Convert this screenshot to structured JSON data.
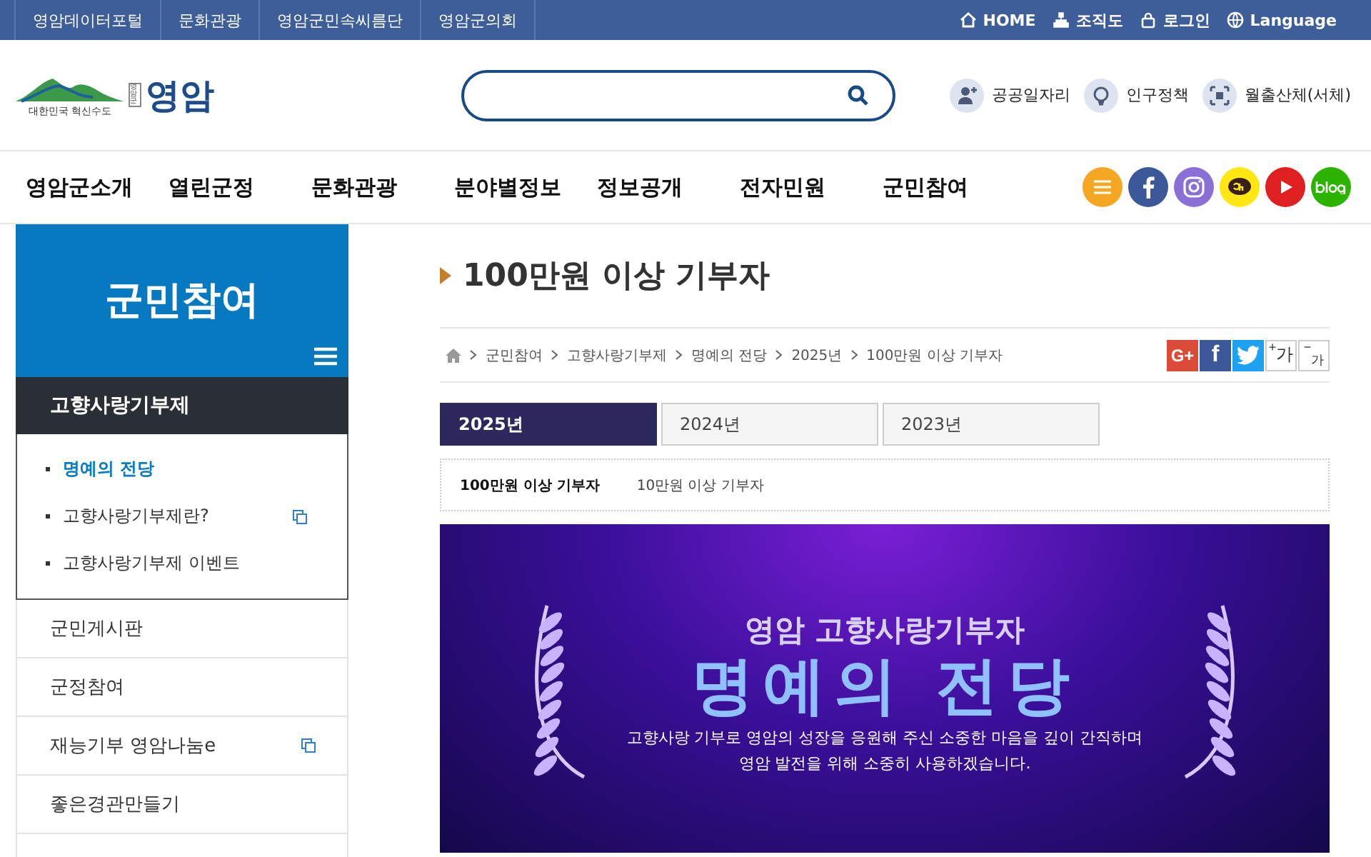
{
  "top_bar": {
    "links": [
      "영암데이터포털",
      "문화관광",
      "영암군민속씨름단",
      "영암군의회"
    ],
    "utility": [
      {
        "kind": "home",
        "label": "HOME"
      },
      {
        "kind": "org",
        "label": "조직도"
      },
      {
        "kind": "lock",
        "label": "로그인"
      },
      {
        "kind": "globe",
        "label": "Language"
      }
    ]
  },
  "header": {
    "logo": {
      "slogan": "대한민국 혁신수도",
      "name": "영암",
      "seal": "영암군"
    },
    "quick_links": [
      {
        "kind": "person",
        "label": "공공일자리"
      },
      {
        "kind": "bulb",
        "label": "인구정책"
      },
      {
        "kind": "frame",
        "label": "월출산체(서체)"
      }
    ]
  },
  "nav": {
    "items": [
      "영암군소개",
      "열린군정",
      "문화관광",
      "분야별정보",
      "정보공개",
      "전자민원",
      "군민참여"
    ],
    "social": [
      {
        "kind": "menu",
        "color": "#f5a623"
      },
      {
        "kind": "facebook",
        "color": "#3b5998"
      },
      {
        "kind": "instagram",
        "color": "#8a6fd6"
      },
      {
        "kind": "kakao",
        "color": "#ffe812"
      },
      {
        "kind": "youtube",
        "color": "#e02020"
      },
      {
        "kind": "blog",
        "color": "#2db400"
      }
    ]
  },
  "sidebar": {
    "title": "군민참여",
    "section": "고향사랑기부제",
    "subitems": [
      {
        "label": "명예의 전당",
        "selected": true,
        "external": false
      },
      {
        "label": "고향사랑기부제란?",
        "selected": false,
        "external": true
      },
      {
        "label": "고향사랑기부제 이벤트",
        "selected": false,
        "external": false
      }
    ],
    "items": [
      {
        "label": "군민게시판",
        "external": false
      },
      {
        "label": "군정참여",
        "external": false
      },
      {
        "label": "재능기부 영암나눔e",
        "external": true
      },
      {
        "label": "좋은경관만들기",
        "external": false
      }
    ]
  },
  "content": {
    "title": "100만원 이상 기부자",
    "breadcrumb": [
      "군민참여",
      "고향사랑기부제",
      "명예의 전당",
      "2025년",
      "100만원 이상 기부자"
    ],
    "share": [
      {
        "kind": "gplus",
        "label": "G+"
      },
      {
        "kind": "facebook",
        "label": "f"
      },
      {
        "kind": "twitter"
      },
      {
        "kind": "zoom_in",
        "label": "가",
        "mark": "+"
      },
      {
        "kind": "zoom_out",
        "label": "가",
        "mark": "−"
      }
    ],
    "year_tabs": [
      {
        "label": "2025년",
        "selected": true
      },
      {
        "label": "2024년",
        "selected": false
      },
      {
        "label": "2023년",
        "selected": false
      }
    ],
    "sub_tabs": [
      {
        "label": "100만원 이상 기부자",
        "selected": true
      },
      {
        "label": "10만원 이상 기부자",
        "selected": false
      }
    ],
    "banner": {
      "kicker": "영암 고향사랑기부자",
      "headline": "명예의 전당",
      "lines": [
        "고향사랑 기부로 영암의 성장을 응원해 주신 소중한 마음을 깊이 간직하며",
        "영암 발전을 위해 소중히 사용하겠습니다."
      ]
    }
  }
}
